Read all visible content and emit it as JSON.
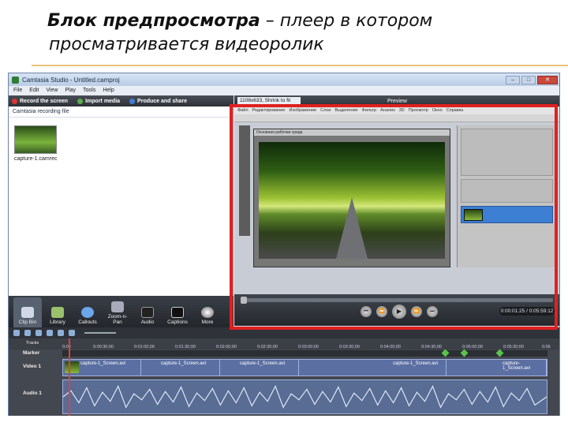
{
  "slide": {
    "title_bold": "Блок предпросмотра",
    "title_rest": " – плеер в котором",
    "title_line2": "просматривается видеоролик"
  },
  "window": {
    "title": "Camtasia Studio - Untitled.camproj",
    "min": "–",
    "max": "□",
    "close": "✕"
  },
  "menu": [
    "File",
    "Edit",
    "View",
    "Play",
    "Tools",
    "Help"
  ],
  "toolbar": {
    "record": "Record the screen",
    "import": "Import media",
    "produce": "Produce and share"
  },
  "clipbin": {
    "header": "Camtasia recording file",
    "file_name": "capture-1.camrec"
  },
  "tasks": [
    "Clip Bin",
    "Library",
    "Callouts",
    "Zoom-n-Pan",
    "Audio",
    "Captions",
    "More"
  ],
  "preview": {
    "zoom": "1108x633, Shrink to fit",
    "label": "Preview",
    "timecode": "0:00:01:25 / 0:05:59:12"
  },
  "photoshop": {
    "menu": [
      "Файл",
      "Редактирование",
      "Изображение",
      "Слои",
      "Выделение",
      "Фильтр",
      "Анализ",
      "3D",
      "Просмотр",
      "Окно",
      "Справка"
    ],
    "doc_tab": "Основная рабочая среда"
  },
  "timeline": {
    "tracks_label": "Tracks",
    "marker": "Marker",
    "video": "Video 1",
    "audio": "Audio 1",
    "ticks": [
      "0:00",
      "0:00:30;00",
      "0:01:00;00",
      "0:01:30;00",
      "0:02:00;00",
      "0:02:30;00",
      "0:03:00;00",
      "0:03:30;00",
      "0:04:00;00",
      "0:04:30;00",
      "0:05:00;00",
      "0:05:30;00",
      "0:06"
    ],
    "clips": [
      "capture-1_Screen.avi",
      "capture-1_Screen.avi",
      "capture-1_Screen.avi",
      "capture-1_Screen.avi",
      "capture-1_Screen.avi"
    ]
  },
  "colors": {
    "accent_frame": "#e02020",
    "rule": "#e8c27a"
  }
}
